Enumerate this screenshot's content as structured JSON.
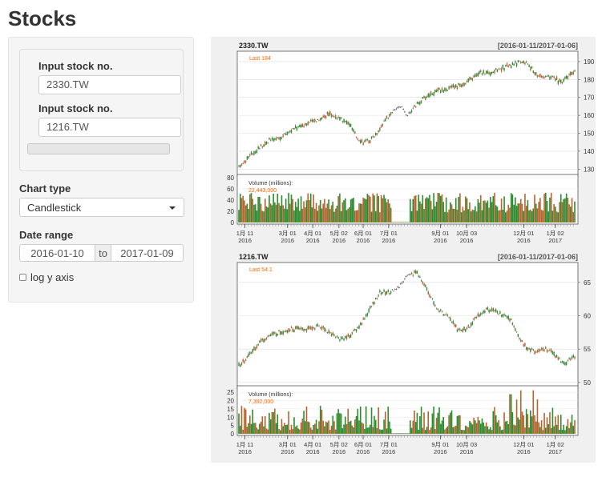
{
  "app": {
    "title": "Stocks"
  },
  "sidebar": {
    "stock1": {
      "label": "Input stock no.",
      "value": "2330.TW"
    },
    "stock2": {
      "label": "Input stock no.",
      "value": "1216.TW"
    },
    "chart_type": {
      "label": "Chart type",
      "selected": "Candlestick"
    },
    "date_range": {
      "label": "Date range",
      "start": "2016-01-10",
      "separator": "to",
      "end": "2017-01-09"
    },
    "log_axis": {
      "label": "log y axis",
      "checked": false
    }
  },
  "charts": [
    {
      "symbol": "2330.TW",
      "range": "[2016-01-11/2017-01-06]",
      "last_label": "Last 184",
      "volume_label": "Volume (millions):",
      "volume_value": "22,443,000",
      "price_ticks": [
        130,
        140,
        150,
        160,
        170,
        180,
        190
      ],
      "volume_ticks": [
        0,
        20,
        40,
        60,
        80
      ]
    },
    {
      "symbol": "1216.TW",
      "range": "[2016-01-11/2017-01-06]",
      "last_label": "Last 54.1",
      "volume_label": "Volume (millions):",
      "volume_value": "7,392,000",
      "price_ticks": [
        50,
        55,
        60,
        65
      ],
      "volume_ticks": [
        0,
        5,
        10,
        15,
        20,
        25
      ]
    }
  ],
  "x_axis_labels": [
    [
      "1月 11",
      "2016"
    ],
    [
      "3月 01",
      "2016"
    ],
    [
      "4月 01",
      "2016"
    ],
    [
      "5月 02",
      "2016"
    ],
    [
      "6月 01",
      "2016"
    ],
    [
      "7月 01",
      "2016"
    ],
    [
      "9月 01",
      "2016"
    ],
    [
      "10月 03",
      "2016"
    ],
    [
      "12月 01",
      "2016"
    ],
    [
      "1月 02",
      "2017"
    ]
  ],
  "chart_data": [
    {
      "type": "candlestick",
      "title": "2330.TW",
      "ylim": [
        127,
        194
      ],
      "volume_ylim": [
        0,
        80
      ],
      "price_path": [
        [
          0,
          131
        ],
        [
          0.03,
          137
        ],
        [
          0.06,
          142
        ],
        [
          0.09,
          146
        ],
        [
          0.12,
          147
        ],
        [
          0.15,
          151
        ],
        [
          0.18,
          154
        ],
        [
          0.21,
          156
        ],
        [
          0.24,
          158
        ],
        [
          0.27,
          161
        ],
        [
          0.29,
          159
        ],
        [
          0.31,
          157
        ],
        [
          0.33,
          155
        ],
        [
          0.35,
          148
        ],
        [
          0.37,
          145
        ],
        [
          0.39,
          146
        ],
        [
          0.41,
          150
        ],
        [
          0.43,
          156
        ],
        [
          0.45,
          160
        ],
        [
          0.47,
          164
        ],
        [
          0.49,
          164
        ],
        [
          0.5,
          160
        ],
        [
          0.52,
          164
        ],
        [
          0.54,
          168
        ],
        [
          0.57,
          172
        ],
        [
          0.6,
          174
        ],
        [
          0.63,
          175
        ],
        [
          0.66,
          177
        ],
        [
          0.69,
          180
        ],
        [
          0.72,
          184
        ],
        [
          0.75,
          184
        ],
        [
          0.78,
          186
        ],
        [
          0.81,
          188
        ],
        [
          0.84,
          190
        ],
        [
          0.86,
          189
        ],
        [
          0.88,
          184
        ],
        [
          0.9,
          181
        ],
        [
          0.92,
          182
        ],
        [
          0.94,
          181
        ],
        [
          0.96,
          178
        ],
        [
          0.98,
          182
        ],
        [
          1.0,
          184
        ]
      ]
    },
    {
      "type": "candlestick",
      "title": "1216.TW",
      "ylim": [
        49.5,
        67.5
      ],
      "volume_ylim": [
        0,
        27
      ],
      "price_path": [
        [
          0,
          52.5
        ],
        [
          0.03,
          54
        ],
        [
          0.06,
          56
        ],
        [
          0.09,
          57
        ],
        [
          0.12,
          57.5
        ],
        [
          0.15,
          58
        ],
        [
          0.18,
          58
        ],
        [
          0.21,
          58
        ],
        [
          0.24,
          58.5
        ],
        [
          0.27,
          57.5
        ],
        [
          0.3,
          56.5
        ],
        [
          0.33,
          57
        ],
        [
          0.36,
          58.5
        ],
        [
          0.39,
          61
        ],
        [
          0.42,
          63.5
        ],
        [
          0.45,
          63.5
        ],
        [
          0.48,
          64.5
        ],
        [
          0.5,
          66
        ],
        [
          0.53,
          66.5
        ],
        [
          0.56,
          64
        ],
        [
          0.59,
          61
        ],
        [
          0.62,
          60
        ],
        [
          0.65,
          58
        ],
        [
          0.68,
          58
        ],
        [
          0.71,
          60
        ],
        [
          0.74,
          61
        ],
        [
          0.77,
          60.5
        ],
        [
          0.79,
          60
        ],
        [
          0.81,
          59.5
        ],
        [
          0.83,
          57
        ],
        [
          0.85,
          55.5
        ],
        [
          0.87,
          55
        ],
        [
          0.89,
          54.5
        ],
        [
          0.91,
          55
        ],
        [
          0.93,
          54.5
        ],
        [
          0.95,
          53.5
        ],
        [
          0.97,
          53
        ],
        [
          0.99,
          53.5
        ],
        [
          1.0,
          54
        ]
      ]
    }
  ],
  "colors": {
    "up": "#2e8b2e",
    "down": "#b5652e",
    "last_label": "#ff6600",
    "panel_bg": "#f0f0f0"
  }
}
